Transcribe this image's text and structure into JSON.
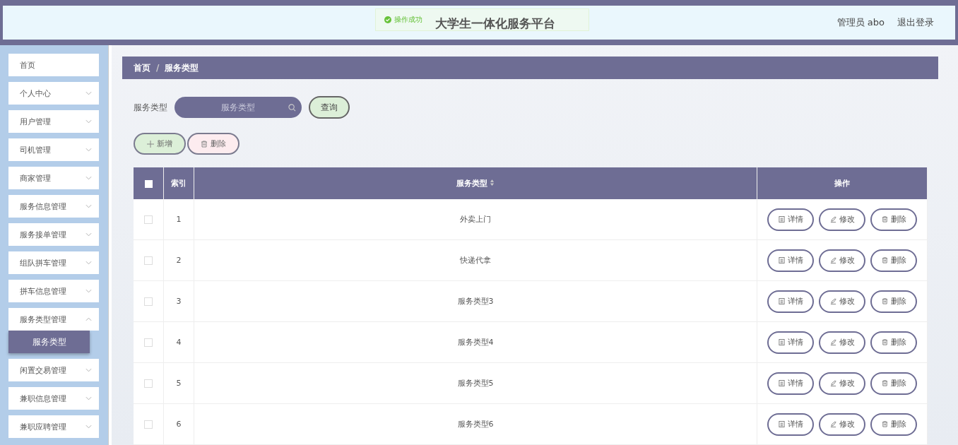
{
  "header": {
    "title": "大学生一体化服务平台",
    "user": "管理员 abo",
    "logout": "退出登录"
  },
  "toast": {
    "text": "操作成功"
  },
  "sidebar": {
    "items": [
      {
        "label": "首页",
        "kind": "page"
      },
      {
        "label": "个人中心",
        "kind": "menu",
        "expanded": false
      },
      {
        "label": "用户管理",
        "kind": "menu",
        "expanded": false
      },
      {
        "label": "司机管理",
        "kind": "menu",
        "expanded": false
      },
      {
        "label": "商家管理",
        "kind": "menu",
        "expanded": false
      },
      {
        "label": "服务信息管理",
        "kind": "menu",
        "expanded": false
      },
      {
        "label": "服务接单管理",
        "kind": "menu",
        "expanded": false
      },
      {
        "label": "组队拼车管理",
        "kind": "menu",
        "expanded": false
      },
      {
        "label": "拼车信息管理",
        "kind": "menu",
        "expanded": false
      },
      {
        "label": "服务类型管理",
        "kind": "menu",
        "expanded": true,
        "children": [
          {
            "label": "服务类型",
            "selected": true
          }
        ]
      },
      {
        "label": "闲置交易管理",
        "kind": "menu",
        "expanded": false
      },
      {
        "label": "兼职信息管理",
        "kind": "menu",
        "expanded": false
      },
      {
        "label": "兼职应聘管理",
        "kind": "menu",
        "expanded": false
      }
    ]
  },
  "breadcrumb": {
    "items": [
      "首页",
      "服务类型"
    ],
    "separator": "/"
  },
  "search": {
    "label": "服务类型",
    "placeholder": "服务类型",
    "button": "查询"
  },
  "actions": {
    "add": "新增",
    "delete": "删除"
  },
  "table": {
    "header_checked": false,
    "columns": [
      "索引",
      "服务类型",
      "操作"
    ],
    "rows": [
      {
        "checked": false,
        "index": "1",
        "name": "外卖上门",
        "buttons": [
          "详情",
          "修改",
          "删除"
        ]
      },
      {
        "checked": false,
        "index": "2",
        "name": "快递代拿",
        "buttons": [
          "详情",
          "修改",
          "删除"
        ]
      },
      {
        "checked": false,
        "index": "3",
        "name": "服务类型3",
        "buttons": [
          "详情",
          "修改",
          "删除"
        ]
      },
      {
        "checked": false,
        "index": "4",
        "name": "服务类型4",
        "buttons": [
          "详情",
          "修改",
          "删除"
        ]
      },
      {
        "checked": false,
        "index": "5",
        "name": "服务类型5",
        "buttons": [
          "详情",
          "修改",
          "删除"
        ]
      },
      {
        "checked": false,
        "index": "6",
        "name": "服务类型6",
        "buttons": [
          "详情",
          "修改",
          "删除"
        ]
      }
    ]
  }
}
